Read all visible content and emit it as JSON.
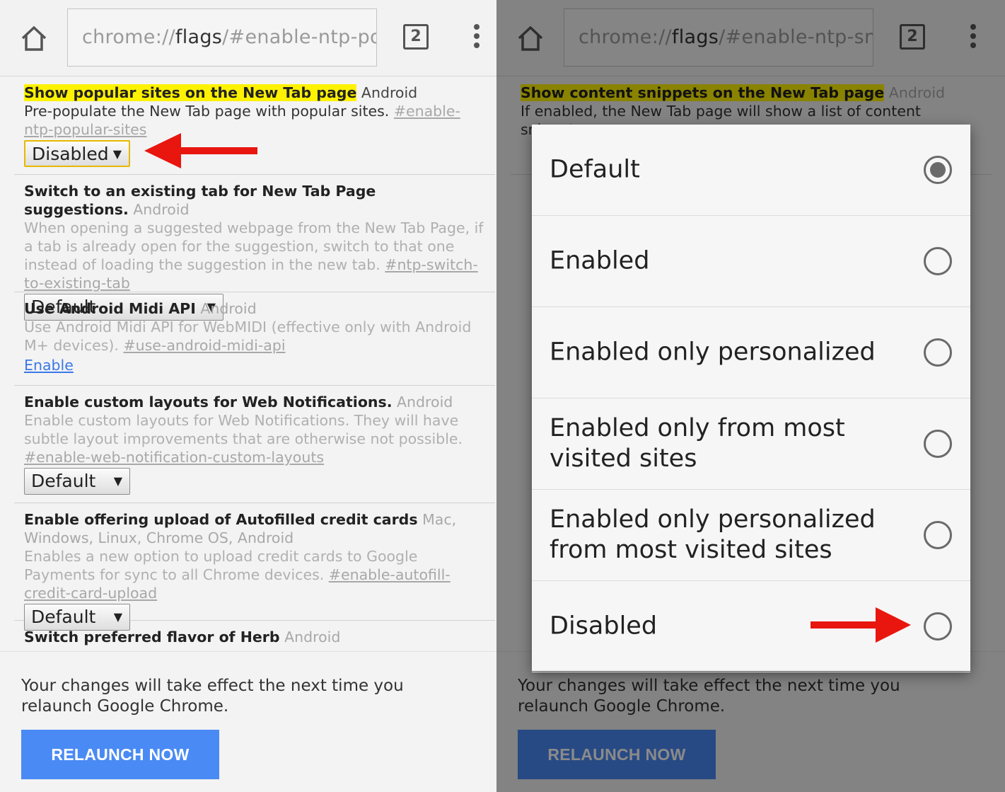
{
  "left": {
    "toolbar": {
      "url_prefix": "chrome://",
      "url_host": "flags",
      "url_path": "/#enable-ntp-popu",
      "tab_count": "2"
    },
    "flags": [
      {
        "title": "Show popular sites on the New Tab page",
        "platforms": "Android",
        "description": "Pre-populate the New Tab page with popular sites.",
        "hash": "#enable-ntp-popular-sites",
        "control": "Disabled"
      },
      {
        "title": "Switch to an existing tab for New Tab Page suggestions.",
        "platforms": "Android",
        "description": "When opening a suggested webpage from the New Tab Page, if a tab is already open for the suggestion, switch to that one instead of loading the suggestion in the new tab.",
        "hash": "#ntp-switch-to-existing-tab",
        "control": "Default"
      },
      {
        "title": "Use Android Midi API",
        "platforms": "Android",
        "description": "Use Android Midi API for WebMIDI (effective only with Android M+ devices).",
        "hash": "#use-android-midi-api",
        "control": "Enable"
      },
      {
        "title": "Enable custom layouts for Web Notifications.",
        "platforms": "Android",
        "description": "Enable custom layouts for Web Notifications. They will have subtle layout improvements that are otherwise not possible.",
        "hash": "#enable-web-notification-custom-layouts",
        "control": "Default"
      },
      {
        "title": "Enable offering upload of Autofilled credit cards",
        "platforms": "Mac, Windows, Linux, Chrome OS, Android",
        "description": "Enables a new option to upload credit cards to Google Payments for sync to all Chrome devices.",
        "hash": "#enable-autofill-credit-card-upload",
        "control": "Default"
      },
      {
        "title": "Switch preferred flavor of Herb",
        "platforms": "Android"
      }
    ],
    "bottom": {
      "message": "Your changes will take effect the next time you relaunch Google Chrome.",
      "button": "RELAUNCH NOW"
    }
  },
  "right": {
    "toolbar": {
      "url_prefix": "chrome://",
      "url_host": "flags",
      "url_path": "/#enable-ntp-snipp",
      "tab_count": "2"
    },
    "flag": {
      "title": "Show content snippets on the New Tab page",
      "platforms": "Android",
      "description": "If enabled, the New Tab page will show a list of content snippets"
    },
    "dialog": {
      "options": [
        {
          "label": "Default",
          "checked": true
        },
        {
          "label": "Enabled",
          "checked": false
        },
        {
          "label": "Enabled only personalized",
          "checked": false
        },
        {
          "label": "Enabled only from most visited sites",
          "checked": false
        },
        {
          "label": "Enabled only personalized from most visited sites",
          "checked": false
        },
        {
          "label": "Disabled",
          "checked": false
        }
      ]
    },
    "bottom": {
      "message": "Your changes will take effect the next time you relaunch Google Chrome.",
      "button": "RELAUNCH NOW"
    }
  },
  "colors": {
    "highlight": "#fff200",
    "link": "#3b78e7",
    "button": "#4a8af4",
    "annotation_arrow": "#e8160f"
  }
}
